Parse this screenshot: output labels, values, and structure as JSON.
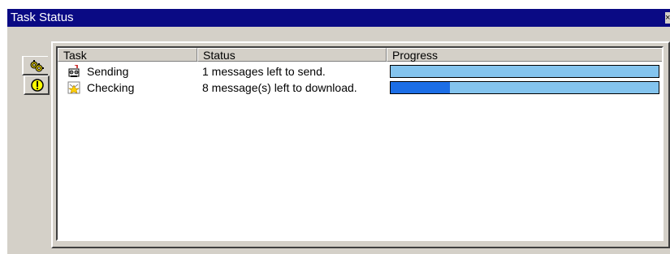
{
  "window": {
    "title": "Task Status",
    "close_glyph": "×"
  },
  "tabs": [
    {
      "icon": "gears-icon",
      "active": true
    },
    {
      "icon": "warning-icon",
      "active": false
    }
  ],
  "columns": [
    "Task",
    "Status",
    "Progress"
  ],
  "rows": [
    {
      "icon": "send-icon",
      "task": "Sending",
      "status": "1 messages left to send.",
      "progress": 0.0
    },
    {
      "icon": "check-mail-icon",
      "task": "Checking",
      "status": "8 message(s) left to download.",
      "progress": 0.22
    }
  ],
  "colors": {
    "titlebar": "#0a0a84",
    "progress_track": "#84c4ee",
    "progress_fill": "#1c6ee6",
    "warning": "#ffff00"
  }
}
